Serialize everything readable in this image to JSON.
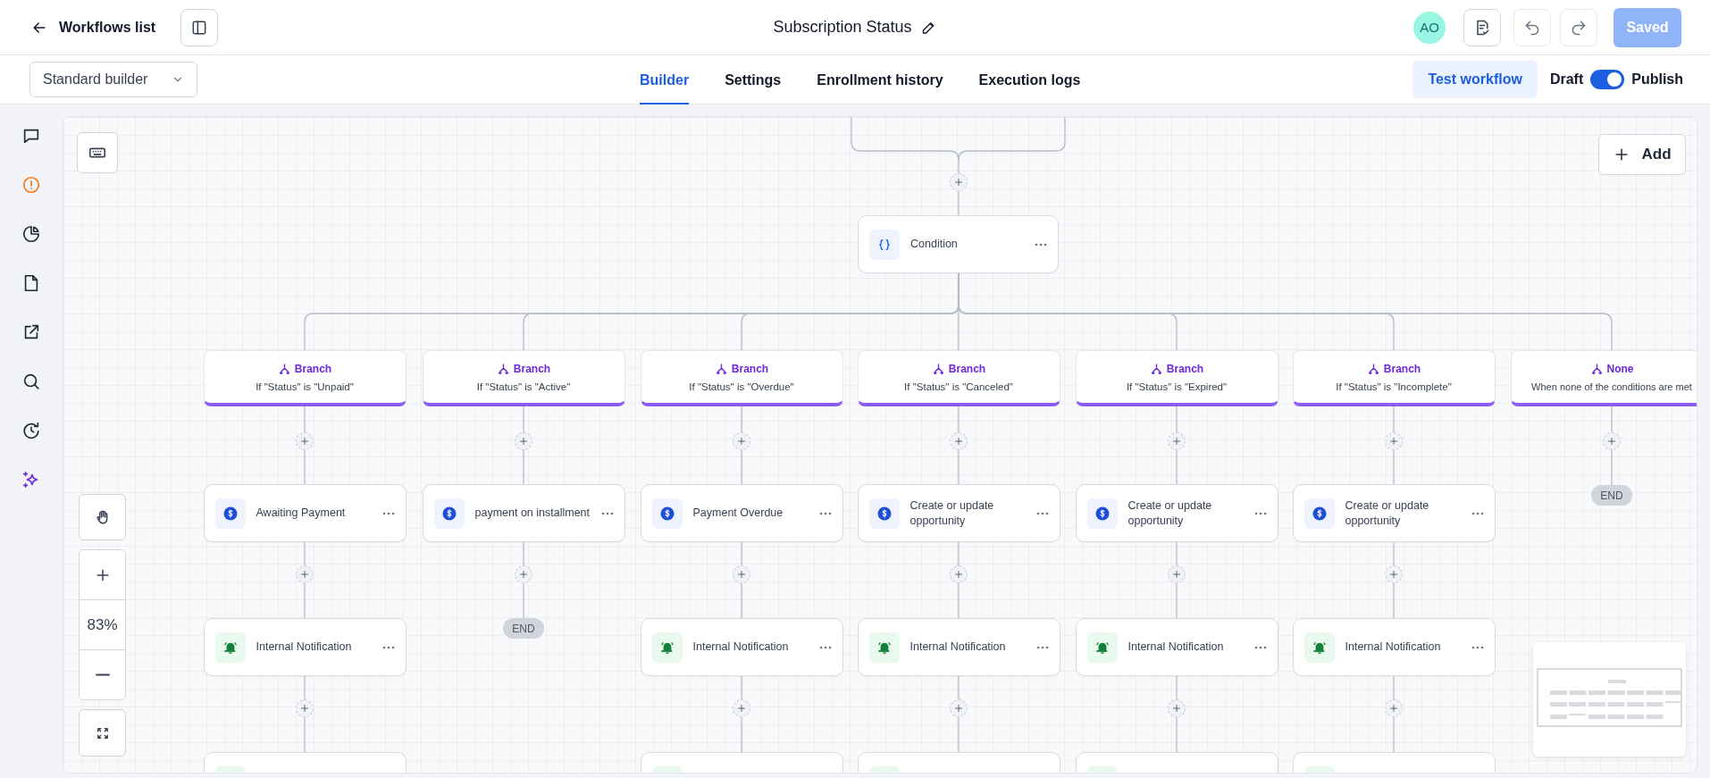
{
  "header": {
    "back_label": "Workflows list",
    "title": "Subscription Status",
    "avatar": "AO",
    "save_label": "Saved"
  },
  "toolbar": {
    "builder_select": "Standard builder",
    "tabs": [
      {
        "label": "Builder",
        "selected": true
      },
      {
        "label": "Settings",
        "selected": false
      },
      {
        "label": "Enrollment history",
        "selected": false
      },
      {
        "label": "Execution logs",
        "selected": false
      }
    ],
    "test_label": "Test workflow",
    "draft_label": "Draft",
    "publish_on": true,
    "publish_label": "Publish"
  },
  "canvas": {
    "add_label": "Add",
    "zoom": "83%",
    "condition": {
      "label": "Condition"
    },
    "branches": [
      {
        "kind": "branch",
        "title": "Branch",
        "condition": "If \"Status\" is \"Unpaid\"",
        "steps": [
          {
            "kind": "payment",
            "label": "Awaiting Payment"
          },
          {
            "kind": "notification",
            "label": "Internal Notification"
          },
          {
            "kind": "notification"
          }
        ]
      },
      {
        "kind": "branch",
        "title": "Branch",
        "condition": "If \"Status\" is \"Active\"",
        "steps": [
          {
            "kind": "payment",
            "label": "payment on installment"
          },
          {
            "kind": "end",
            "label": "END"
          }
        ]
      },
      {
        "kind": "branch",
        "title": "Branch",
        "condition": "If \"Status\" is \"Overdue\"",
        "steps": [
          {
            "kind": "payment",
            "label": "Payment Overdue"
          },
          {
            "kind": "notification",
            "label": "Internal Notification"
          },
          {
            "kind": "notification"
          }
        ]
      },
      {
        "kind": "branch",
        "title": "Branch",
        "condition": "If \"Status\" is \"Canceled\"",
        "steps": [
          {
            "kind": "payment",
            "label": "Create or update opportunity"
          },
          {
            "kind": "notification",
            "label": "Internal Notification"
          },
          {
            "kind": "notification"
          }
        ]
      },
      {
        "kind": "branch",
        "title": "Branch",
        "condition": "If \"Status\" is \"Expired\"",
        "steps": [
          {
            "kind": "payment",
            "label": "Create or update opportunity"
          },
          {
            "kind": "notification",
            "label": "Internal Notification"
          },
          {
            "kind": "notification"
          }
        ]
      },
      {
        "kind": "branch",
        "title": "Branch",
        "condition": "If \"Status\" is \"Incomplete\"",
        "steps": [
          {
            "kind": "payment",
            "label": "Create or update opportunity"
          },
          {
            "kind": "notification",
            "label": "Internal Notification"
          },
          {
            "kind": "notification"
          }
        ]
      },
      {
        "kind": "none",
        "title": "None",
        "condition": "When none of the conditions are met",
        "steps": [
          {
            "kind": "end",
            "label": "END"
          }
        ]
      }
    ]
  }
}
